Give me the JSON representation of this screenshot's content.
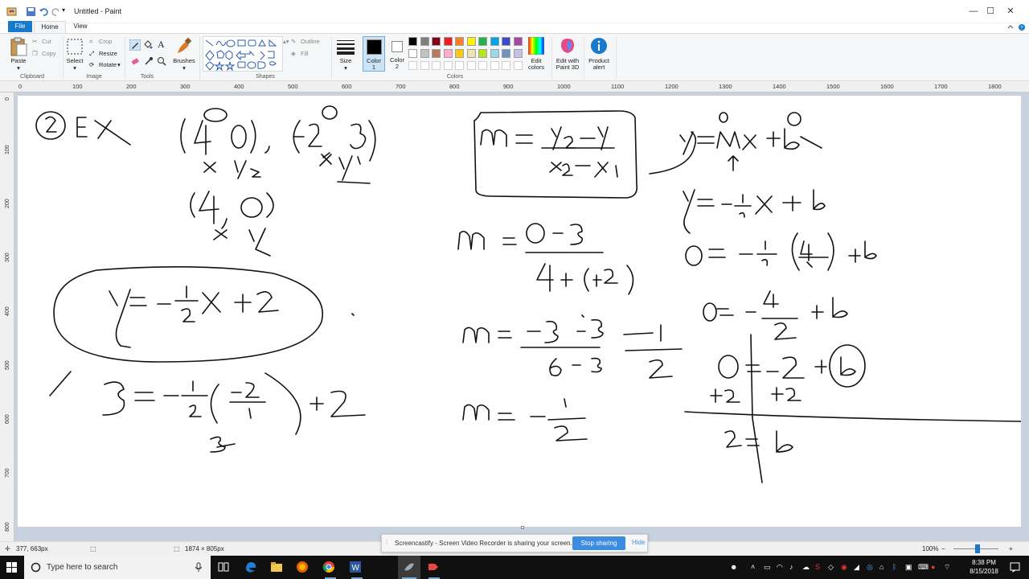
{
  "window": {
    "title": "Untitled - Paint",
    "minimize": "—",
    "maximize": "☐",
    "close": "✕"
  },
  "tabs": {
    "file": "File",
    "home": "Home",
    "view": "View"
  },
  "ribbon": {
    "clipboard": {
      "paste": "Paste",
      "cut": "Cut",
      "copy": "Copy",
      "label": "Clipboard"
    },
    "image": {
      "select": "Select",
      "crop": "Crop",
      "resize": "Resize",
      "rotate": "Rotate",
      "label": "Image"
    },
    "tools": {
      "label": "Tools",
      "text_tool": "A"
    },
    "brushes": {
      "label": "Brushes"
    },
    "shapes": {
      "label": "Shapes",
      "outline": "Outline",
      "fill": "Fill"
    },
    "size": {
      "label": "Size"
    },
    "color1": {
      "label1": "Color",
      "label2": "1"
    },
    "color2": {
      "label1": "Color",
      "label2": "2"
    },
    "colors": {
      "label": "Colors"
    },
    "edit_colors": {
      "label1": "Edit",
      "label2": "colors"
    },
    "paint3d": {
      "label1": "Edit with",
      "label2": "Paint 3D"
    },
    "product_alert": {
      "label1": "Product",
      "label2": "alert"
    }
  },
  "palette": {
    "row1": [
      "#000000",
      "#7f7f7f",
      "#880015",
      "#ed1c24",
      "#ff7f27",
      "#fff200",
      "#22b14c",
      "#00a2e8",
      "#3f48cc",
      "#a349a4"
    ],
    "row2": [
      "#ffffff",
      "#c3c3c3",
      "#b97a57",
      "#ffaec9",
      "#ffc90e",
      "#efe4b0",
      "#b5e61d",
      "#99d9ea",
      "#7092be",
      "#c8bfe7"
    ],
    "row3": [
      "#ffffff",
      "#ffffff",
      "#ffffff",
      "#ffffff",
      "#ffffff",
      "#ffffff",
      "#ffffff",
      "#ffffff",
      "#ffffff",
      "#ffffff"
    ]
  },
  "ruler": {
    "top": [
      "0",
      "100",
      "200",
      "300",
      "400",
      "500",
      "600",
      "700",
      "800",
      "900",
      "1000",
      "1100",
      "1200",
      "1300",
      "1400",
      "1500",
      "1600",
      "1700",
      "1800"
    ],
    "left": [
      "0",
      "100",
      "200",
      "300",
      "400",
      "500",
      "600",
      "700",
      "800"
    ]
  },
  "status": {
    "cursor": "377, 663px",
    "size": "1874 × 805px",
    "zoom": "100%",
    "zoom_minus": "−",
    "zoom_plus": "+"
  },
  "screencastify": {
    "message": "Screencastify - Screen Video Recorder is sharing your screen.",
    "stop": "Stop sharing",
    "hide": "Hide"
  },
  "taskbar": {
    "search_placeholder": "Type here to search",
    "time": "8:38 PM",
    "date": "8/15/2018"
  }
}
